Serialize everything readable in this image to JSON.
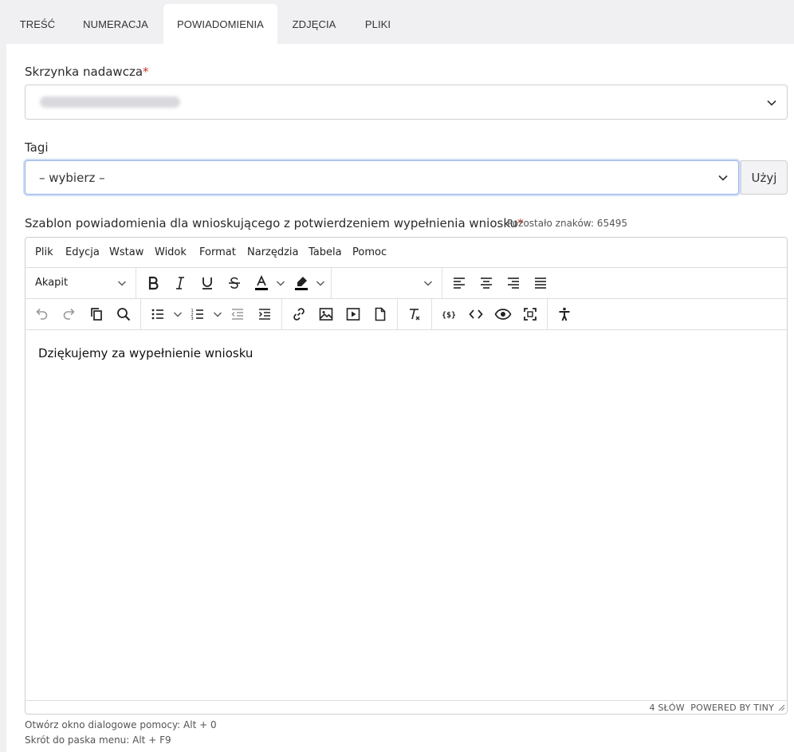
{
  "tabs": [
    {
      "label": "TREŚĆ",
      "active": false
    },
    {
      "label": "NUMERACJA",
      "active": false
    },
    {
      "label": "POWIADOMIENIA",
      "active": true
    },
    {
      "label": "ZDJĘCIA",
      "active": false
    },
    {
      "label": "PLIKI",
      "active": false
    }
  ],
  "sender_box": {
    "label": "Skrzynka nadawcza",
    "required_mark": "*",
    "value_redacted": true
  },
  "tags": {
    "label": "Tagi",
    "value": "– wybierz –",
    "apply_label": "Użyj"
  },
  "template": {
    "label": "Szablon powiadomienia dla wnioskującego z potwierdzeniem wypełnienia wniosku",
    "required_mark": "*",
    "counter": "Pozostało znaków: 65495"
  },
  "editor": {
    "menu": [
      "Plik",
      "Edycja",
      "Wstaw",
      "Widok",
      "Format",
      "Narzędzia",
      "Tabela",
      "Pomoc"
    ],
    "block_format": "Akapit",
    "content": "Dziękujemy za wypełnienie wniosku",
    "word_count": "4 SŁÓW",
    "powered_by": "POWERED BY TINY"
  },
  "help": {
    "line1": "Otwórz okno dialogowe pomocy: Alt + 0",
    "line2": "Skrót do paska menu: Alt + F9"
  },
  "colors": {
    "accent_focus": "#9db9e8",
    "required": "#c0392b",
    "tab_bar": "#f0f0f2"
  }
}
